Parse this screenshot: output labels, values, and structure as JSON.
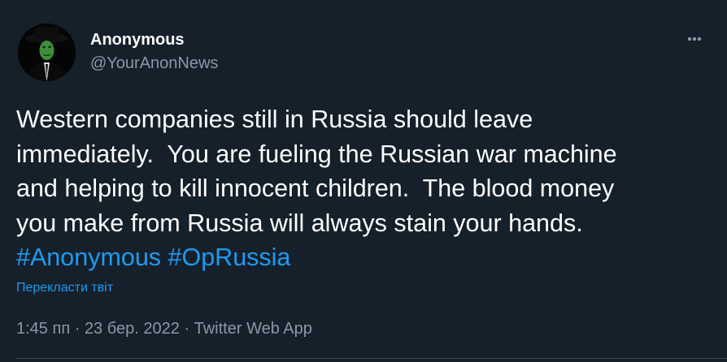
{
  "author": {
    "display_name": "Anonymous",
    "handle": "@YourAnonNews",
    "avatar_icon": "anonymous-mask-avatar"
  },
  "tweet": {
    "lines": [
      "Western companies still in Russia should leave",
      "immediately.  You are fueling the Russian war machine",
      "and helping to kill innocent children.  The blood money",
      "you make from Russia will always stain your hands."
    ],
    "hashtags": [
      "#Anonymous",
      "#OpRussia"
    ]
  },
  "translate_label": "Перекласти твіт",
  "meta": {
    "time": "1:45 пп",
    "separator": " · ",
    "date": "23 бер. 2022",
    "source": "Twitter Web App"
  },
  "colors": {
    "background": "#15202b",
    "text": "#ffffff",
    "secondary_text": "#8b98a5",
    "accent": "#1d9bf0"
  }
}
